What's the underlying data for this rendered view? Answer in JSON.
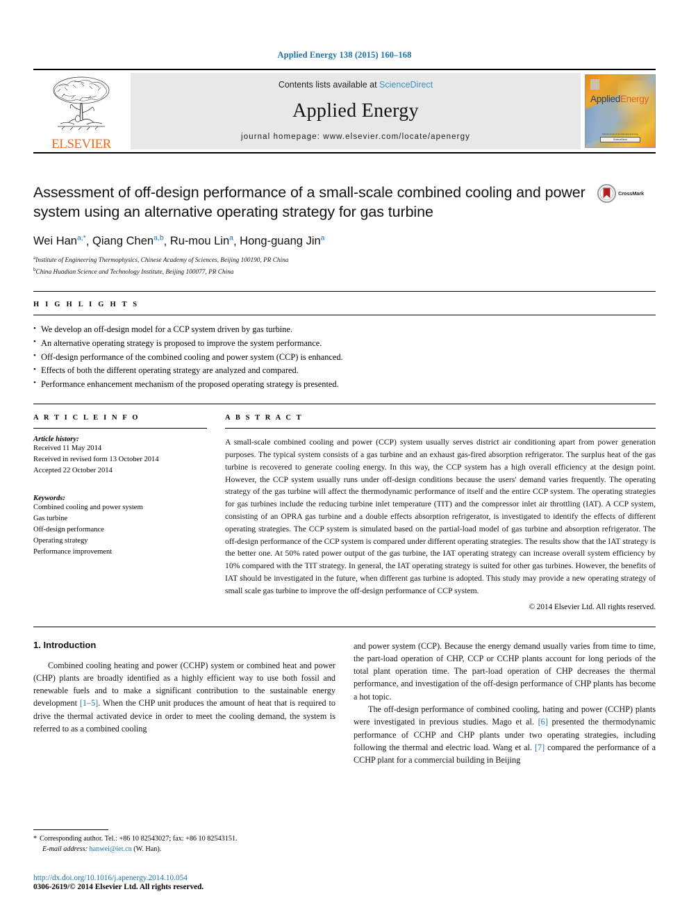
{
  "journal_ref": "Applied Energy 138 (2015) 160–168",
  "masthead": {
    "publisher_name": "ELSEVIER",
    "contents_prefix": "Contents lists available at ",
    "contents_link": "ScienceDirect",
    "journal_title": "Applied Energy",
    "homepage": "journal homepage: www.elsevier.com/locate/apenergy",
    "cover": {
      "title_part1": "Applied",
      "title_part2": "Energy",
      "footer_text": "Official journal of the International Energy",
      "footer_badge": "ScienceDirect"
    }
  },
  "article": {
    "title": "Assessment of off-design performance of a small-scale combined cooling and power system using an alternative operating strategy for gas turbine",
    "crossmark_label": "CrossMark",
    "authors": [
      {
        "name": "Wei Han",
        "sup": "a,*"
      },
      {
        "name": "Qiang Chen",
        "sup": "a,b"
      },
      {
        "name": "Ru-mou Lin",
        "sup": "a"
      },
      {
        "name": "Hong-guang Jin",
        "sup": "a"
      }
    ],
    "affiliations": [
      {
        "marker": "a",
        "text": "Institute of Engineering Thermophysics, Chinese Academy of Sciences, Beijing 100190, PR China"
      },
      {
        "marker": "b",
        "text": "China Huadian Science and Technology Institute, Beijing 100077, PR China"
      }
    ]
  },
  "highlights": {
    "heading": "H I G H L I G H T S",
    "items": [
      "We develop an off-design model for a CCP system driven by gas turbine.",
      "An alternative operating strategy is proposed to improve the system performance.",
      "Off-design performance of the combined cooling and power system (CCP) is enhanced.",
      "Effects of both the different operating strategy are analyzed and compared.",
      "Performance enhancement mechanism of the proposed operating strategy is presented."
    ]
  },
  "article_info": {
    "heading": "A R T I C L E   I N F O",
    "history_label": "Article history:",
    "history": [
      "Received 11 May 2014",
      "Received in revised form 13 October 2014",
      "Accepted 22 October 2014"
    ],
    "keywords_label": "Keywords:",
    "keywords": [
      "Combined cooling and power system",
      "Gas turbine",
      "Off-design performance",
      "Operating strategy",
      "Performance improvement"
    ]
  },
  "abstract": {
    "heading": "A B S T R A C T",
    "text": "A small-scale combined cooling and power (CCP) system usually serves district air conditioning apart from power generation purposes. The typical system consists of a gas turbine and an exhaust gas-fired absorption refrigerator. The surplus heat of the gas turbine is recovered to generate cooling energy. In this way, the CCP system has a high overall efficiency at the design point. However, the CCP system usually runs under off-design conditions because the users' demand varies frequently. The operating strategy of the gas turbine will affect the thermodynamic performance of itself and the entire CCP system. The operating strategies for gas turbines include the reducing turbine inlet temperature (TIT) and the compressor inlet air throttling (IAT). A CCP system, consisting of an OPRA gas turbine and a double effects absorption refrigerator, is investigated to identify the effects of different operating strategies. The CCP system is simulated based on the partial-load model of gas turbine and absorption refrigerator. The off-design performance of the CCP system is compared under different operating strategies. The results show that the IAT strategy is the better one. At 50% rated power output of the gas turbine, the IAT operating strategy can increase overall system efficiency by 10% compared with the TIT strategy. In general, the IAT operating strategy is suited for other gas turbines. However, the benefits of IAT should be investigated in the future, when different gas turbine is adopted. This study may provide a new operating strategy of small scale gas turbine to improve the off-design performance of CCP system.",
    "copyright": "© 2014 Elsevier Ltd. All rights reserved."
  },
  "body": {
    "section_heading": "1. Introduction",
    "left_paragraphs": [
      {
        "before": "Combined cooling heating and power (CCHP) system or combined heat and power (CHP) plants are broadly identified as a highly efficient way to use both fossil and renewable fuels and to make a significant contribution to the sustainable energy development ",
        "ref": "[1–5]",
        "after": ". When the CHP unit produces the amount of heat that is required to drive the thermal activated device in order to meet the cooling demand, the system is referred to as a combined cooling"
      }
    ],
    "right_paragraph_1": "and power system (CCP). Because the energy demand usually varies from time to time, the part-load operation of CHP, CCP or CCHP plants account for long periods of the total plant operation time. The part-load operation of CHP decreases the thermal performance, and investigation of the off-design performance of CHP plants has become a hot topic.",
    "right_paragraph_2": {
      "seg1": "The off-design performance of combined cooling, hating and power (CCHP) plants were investigated in previous studies. Mago et al. ",
      "ref1": "[6]",
      "seg2": " presented the thermodynamic performance of CCHP and CHP plants under two operating strategies, including following the thermal and electric load. Wang et al. ",
      "ref2": "[7]",
      "seg3": " compared the performance of a CCHP plant for a commercial building in Beijing"
    }
  },
  "footnotes": {
    "corresponding": "Corresponding author. Tel.: +86 10 82543027; fax: +86 10 82543151.",
    "email_label": "E-mail address:",
    "email": "hanwei@iet.cn",
    "email_suffix": "(W. Han).",
    "doi": "http://dx.doi.org/10.1016/j.apenergy.2014.10.054",
    "issn": "0306-2619/© 2014 Elsevier Ltd. All rights reserved."
  },
  "colors": {
    "link_blue": "#1b72a8",
    "elsevier_orange": "#ea6a20",
    "sciencedirect_blue": "#3b8fc4"
  }
}
